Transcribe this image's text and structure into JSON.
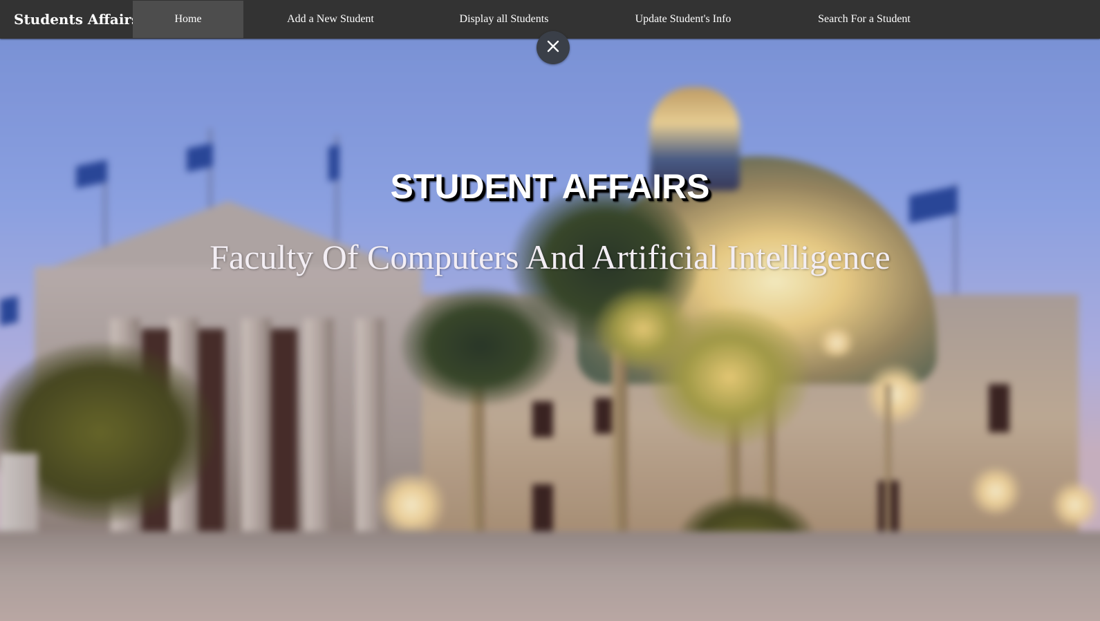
{
  "navbar": {
    "brand": "Students Affairs",
    "items": [
      {
        "label": "Home",
        "active": true
      },
      {
        "label": "Add a New Student",
        "active": false
      },
      {
        "label": "Display all Students",
        "active": false
      },
      {
        "label": "Update Student's Info",
        "active": false
      },
      {
        "label": "Search For a Student",
        "active": false
      }
    ]
  },
  "overlay_close": {
    "icon": "close-icon",
    "glyph": "✕"
  },
  "hero": {
    "title": "STUDENT AFFAIRS",
    "subtitle": "Faculty Of Computers And Artificial Intelligence"
  },
  "colors": {
    "navbar_bg": "#333333",
    "nav_active_bg": "#4d4d4d",
    "nav_text": "#ffffff",
    "close_button_bg": "#3a3f48"
  }
}
